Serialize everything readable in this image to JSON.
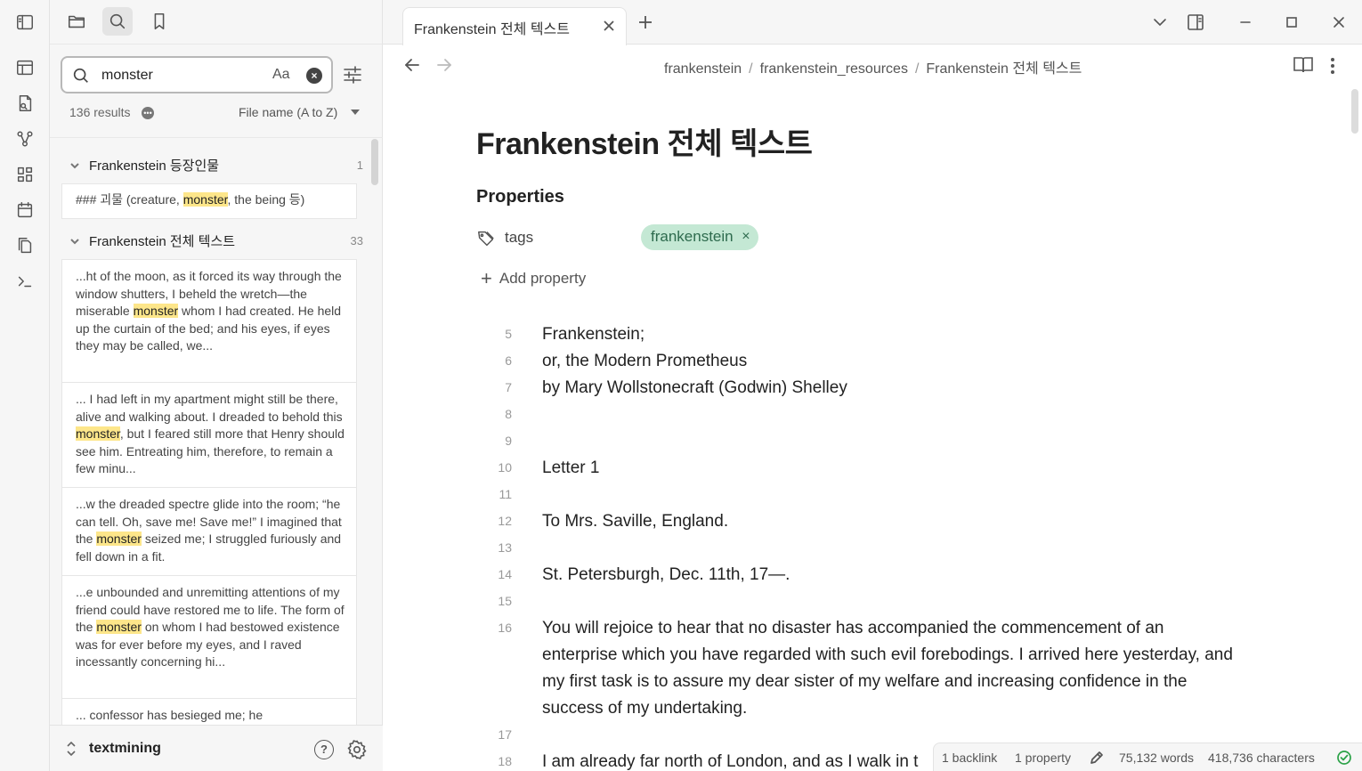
{
  "ribbon": {
    "icons": [
      "sidebar-toggle-icon",
      "canvas-icon",
      "new-note-icon",
      "graph-view-icon",
      "dashboard-icon",
      "calendar-icon",
      "copy-icon",
      "terminal-icon"
    ]
  },
  "sidebar": {
    "tabs": [
      "folder-icon",
      "search-icon",
      "bookmark-icon"
    ],
    "active_tab": "search",
    "search": {
      "query": "monster",
      "match_case_label": "Aa",
      "results_count": "136 results",
      "sort_label": "File name (A to Z)"
    },
    "groups": [
      {
        "title": "Frankenstein 등장인물",
        "count": "1",
        "matches": [
          {
            "before": "### 괴물 (creature, ",
            "hit": "monster",
            "after": ", the being 등)"
          }
        ]
      },
      {
        "title": "Frankenstein 전체 텍스트",
        "count": "33",
        "matches": [
          {
            "before": "...ht of the moon, as it forced its way through the window shutters, I beheld the wretch—the miserable ",
            "hit": "monster",
            "after": " whom I had created. He held up the curtain of the bed; and his eyes, if eyes they may be called, we..."
          },
          {
            "before": "... I had left in my apartment might still be there, alive and walking about. I dreaded to behold this ",
            "hit": "monster",
            "after": ", but I feared still more that Henry should see him. Entreating him, therefore, to remain a few minu..."
          },
          {
            "before": "...w the dreaded spectre glide into the room; “he can tell. Oh, save me! Save me!” I imagined that the ",
            "hit": "monster",
            "after": " seized me; I struggled furiously and fell down in a fit."
          },
          {
            "before": "...e unbounded and unremitting attentions of my friend could have restored me to life. The form of the ",
            "hit": "monster",
            "after": " on whom I had bestowed existence was for ever before my eyes, and I raved incessantly concerning hi..."
          },
          {
            "before": "... confessor has besieged me; he",
            "hit": "",
            "after": ""
          }
        ]
      }
    ],
    "vault_name": "textmining"
  },
  "tab": {
    "title": "Frankenstein 전체 텍스트"
  },
  "breadcrumb": [
    "frankenstein",
    "frankenstein_resources",
    "Frankenstein 전체 텍스트"
  ],
  "document": {
    "title": "Frankenstein 전체 텍스트",
    "properties_heading": "Properties",
    "property_key": "tags",
    "tag_value": "frankenstein",
    "tag_remove": "×",
    "add_property_label": "Add property",
    "lines": [
      {
        "num": "5",
        "text": "Frankenstein;"
      },
      {
        "num": "6",
        "text": "or, the Modern Prometheus"
      },
      {
        "num": "7",
        "text": "by Mary Wollstonecraft (Godwin) Shelley"
      },
      {
        "num": "8",
        "text": ""
      },
      {
        "num": "9",
        "text": ""
      },
      {
        "num": "10",
        "text": "Letter 1"
      },
      {
        "num": "11",
        "text": ""
      },
      {
        "num": "12",
        "text": "To Mrs. Saville, England."
      },
      {
        "num": "13",
        "text": ""
      },
      {
        "num": "14",
        "text": "St. Petersburgh, Dec. 11th, 17—."
      },
      {
        "num": "15",
        "text": ""
      },
      {
        "num": "16",
        "text": "You will rejoice to hear that no disaster has accompanied the commencement of an enterprise which you have regarded with such evil forebodings. I arrived here yesterday, and my first task is to assure my dear sister of my welfare and increasing confidence in the success of my undertaking."
      },
      {
        "num": "17",
        "text": ""
      },
      {
        "num": "18",
        "text": "I am already far north of London, and as I walk in t"
      }
    ]
  },
  "status": {
    "backlinks": "1 backlink",
    "properties": "1 property",
    "words": "75,132 words",
    "characters": "418,736 characters",
    "sync_color": "#2aa146"
  },
  "colors": {
    "accent": "#e4e4e4",
    "highlight": "#fde68a",
    "tag_bg": "#c4e8d4",
    "tag_text": "#2e6b4e"
  }
}
